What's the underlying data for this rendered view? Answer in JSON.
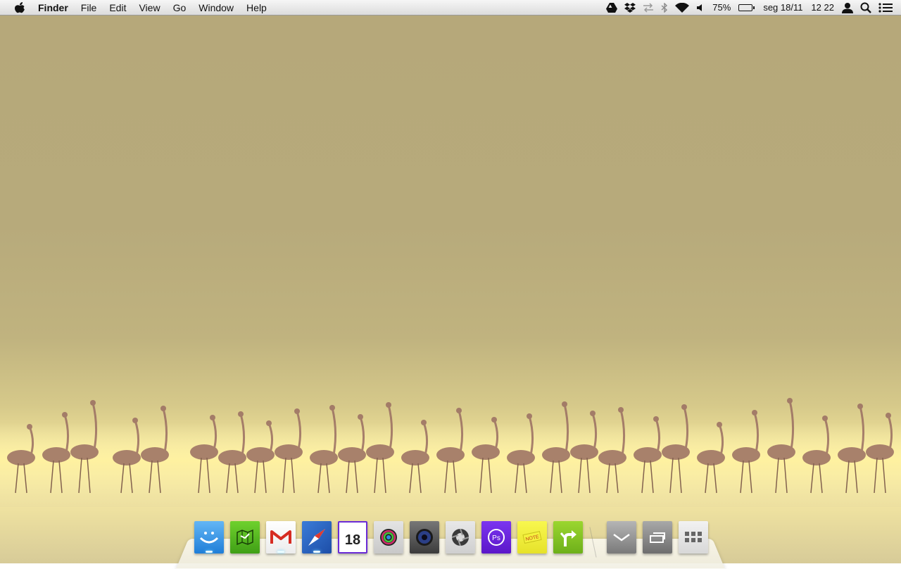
{
  "menubar": {
    "app_name": "Finder",
    "menus": [
      "File",
      "Edit",
      "View",
      "Go",
      "Window",
      "Help"
    ],
    "status": {
      "battery_percent": "75%",
      "date": "seg 18/11",
      "time": "12 22"
    }
  },
  "dock": {
    "calendar_day": "18",
    "icons": [
      {
        "name": "finder-icon",
        "color": "#2f8ee6"
      },
      {
        "name": "maps-icon",
        "color": "#49b61e"
      },
      {
        "name": "gmail-icon",
        "color": "#ffffff"
      },
      {
        "name": "safari-icon",
        "color": "#2a63c8"
      },
      {
        "name": "calendar-icon",
        "color": "#ffffff"
      },
      {
        "name": "game-center-icon",
        "color": "#d9d9d9"
      },
      {
        "name": "camera-icon",
        "color": "#5a5a5a"
      },
      {
        "name": "aperture-icon",
        "color": "#d9d9d9"
      },
      {
        "name": "photoshop-icon",
        "color": "#6a1fe0"
      },
      {
        "name": "stickies-icon",
        "color": "#f1f03b"
      },
      {
        "name": "directions-icon",
        "color": "#8bc724"
      },
      {
        "name": "downloads-stack-icon",
        "color": "#8a8a8a"
      },
      {
        "name": "windows-stack-icon",
        "color": "#8a8a8a"
      },
      {
        "name": "launchpad-icon",
        "color": "#e6e6e6"
      }
    ]
  }
}
